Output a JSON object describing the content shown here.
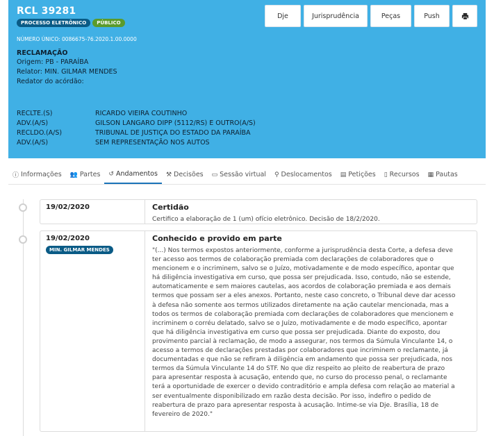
{
  "header": {
    "title": "RCL 39281",
    "badges": [
      "PROCESSO ELETRÔNICO",
      "PÚBLICO"
    ],
    "numero_unico": "NÚMERO ÚNICO: 0086675-76.2020.1.00.0000",
    "classe": "RECLAMAÇÃO",
    "origem": "Origem: PB - PARAÍBA",
    "relator": "Relator: MIN. GILMAR MENDES",
    "redator": "Redator do acórdão:",
    "parties": [
      {
        "role": "RECLTE.(S)",
        "name": "RICARDO VIEIRA COUTINHO"
      },
      {
        "role": "ADV.(A/S)",
        "name": "GILSON LANGARO DIPP (5112/RS) E OUTRO(A/S)"
      },
      {
        "role": "RECLDO.(A/S)",
        "name": "TRIBUNAL DE JUSTIÇA DO ESTADO DA PARAÍBA"
      },
      {
        "role": "ADV.(A/S)",
        "name": "SEM REPRESENTAÇÃO NOS AUTOS"
      }
    ],
    "colors": {
      "header_bg": "#40b0e5",
      "badge_blue": "#0a5b86",
      "badge_green": "#5b9b2c"
    }
  },
  "toolbar": {
    "dje": "Dje",
    "jurisprudencia": "Jurisprudência",
    "pecas": "Peças",
    "push": "Push",
    "print_icon": "printer-icon"
  },
  "tabs": [
    {
      "label": "Informações",
      "icon": "info-icon"
    },
    {
      "label": "Partes",
      "icon": "users-icon"
    },
    {
      "label": "Andamentos",
      "icon": "history-icon",
      "active": true
    },
    {
      "label": "Decisões",
      "icon": "gavel-icon"
    },
    {
      "label": "Sessão virtual",
      "icon": "monitor-icon"
    },
    {
      "label": "Deslocamentos",
      "icon": "map-marker-icon"
    },
    {
      "label": "Petições",
      "icon": "file-icon"
    },
    {
      "label": "Recursos",
      "icon": "document-icon"
    },
    {
      "label": "Pautas",
      "icon": "calendar-icon"
    }
  ],
  "events": [
    {
      "date": "19/02/2020",
      "title": "Certidão",
      "description": "Certifico a elaboração de 1 (um) ofício eletrônico. Decisão de 18/2/2020."
    },
    {
      "date": "19/02/2020",
      "badge": "MIN. GILMAR MENDES",
      "title": "Conhecido e provido em parte",
      "lines": [
        "\"(...) Nos termos expostos anteriormente, conforme a jurisprudência desta Corte, a defesa deve",
        "ter acesso aos termos de colaboração premiada com declarações de colaboradores que o",
        "mencionem e o incriminem, salvo se o Juízo, motivadamente e de modo específico, apontar que",
        "há diligência investigativa em curso, que possa ser prejudicada. Isso, contudo, não se estende,",
        "automaticamente e sem maiores cautelas, aos acordos de colaboração premiada e aos demais",
        "termos que possam ser a eles anexos. Portanto, neste caso concreto, o Tribunal deve dar acesso",
        "à defesa não somente aos termos utilizados diretamente na ação cautelar mencionada, mas a",
        "todos os termos de colaboração premiada com declarações de colaboradores que mencionem e",
        "incriminem o corréu delatado, salvo se o Juízo, motivadamente e de modo específico, apontar",
        "que há diligência investigativa em curso que possa ser prejudicada. Diante do exposto, dou",
        "provimento parcial à reclamação, de modo a assegurar, nos termos da Súmula Vinculante 14, o",
        "acesso a termos de declarações prestadas por colaboradores que incriminem o reclamante, já",
        "documentadas e que não se refiram à diligência em andamento que possa ser prejudicada, nos",
        "termos da Súmula Vinculante 14 do STF. No que diz respeito ao pleito de reabertura de prazo",
        "para apresentar resposta à acusação, entendo que, no curso do processo penal, o reclamante",
        "terá a oportunidade de exercer o devido contraditório e ampla defesa com relação ao material a",
        "ser eventualmente disponibilizado em razão desta decisão. Por isso, indefiro o pedido de",
        "reabertura de prazo para apresentar resposta à acusação. Intime-se via Dje. Brasília, 18 de",
        "fevereiro de 2020.\""
      ]
    }
  ]
}
